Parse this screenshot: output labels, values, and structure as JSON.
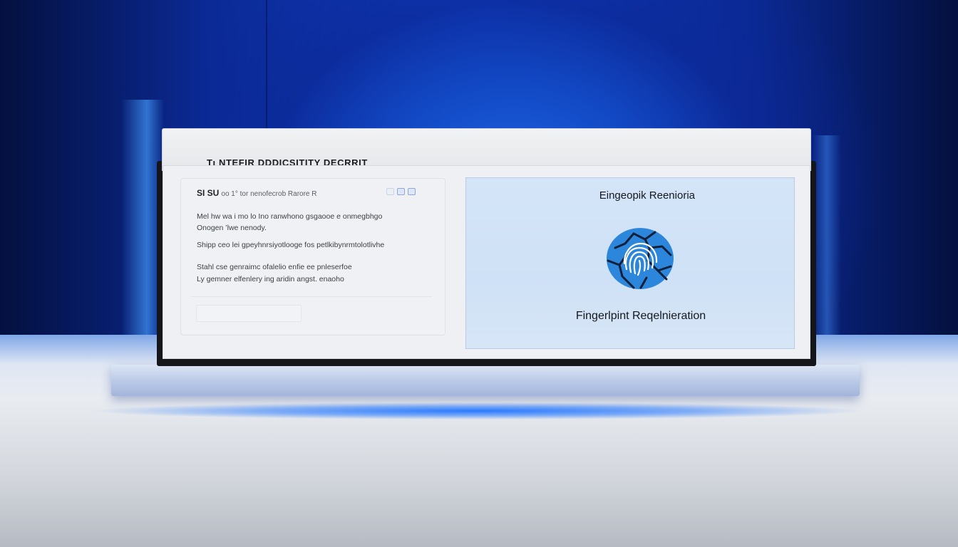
{
  "window": {
    "title": "Tı NTEFIR DDDICSITITY DECRRIT"
  },
  "left_panel": {
    "header_lead": "SI SU",
    "header_rest": "oo 1° tor nenofecrob Rarore R",
    "lines": [
      "Mel hw wa i mo lo  Ino ranwhono gsgaooe e onmegbhgo",
      "Onogen ’lwe nenody.",
      "Shipp ceo lei gpeyhnrsiyotlooge  fos petlkibynrmtolotlivhe",
      "Stahl  cse genraimc ofalelio enfie ee pnleserfoe",
      "Ly gemner elfenlery ing aridin angst. enaoho"
    ],
    "icons": [
      "window-icon",
      "window-icon",
      "window-icon"
    ]
  },
  "right_panel": {
    "title": "Eingeopik Reenioria",
    "caption": "Fingerlpint Reqelnieration",
    "icon": "fingerprint-icon",
    "accent": "#2c86db",
    "crack_color": "#10203a"
  }
}
